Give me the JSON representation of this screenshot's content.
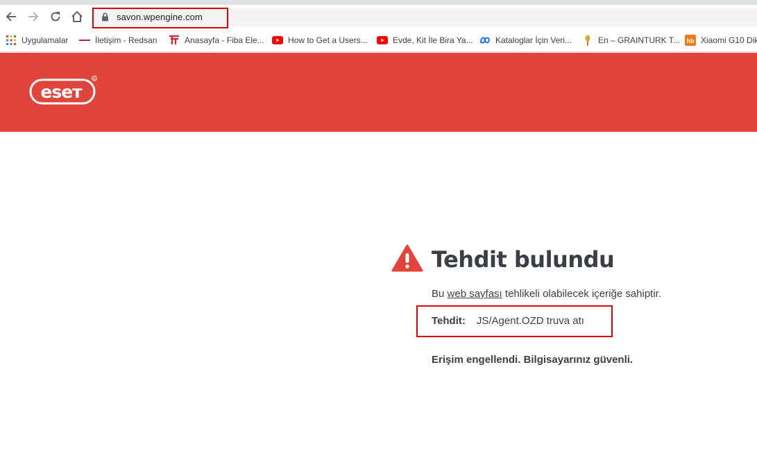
{
  "browser": {
    "url": "savon.wpengine.com",
    "bookmarks": [
      {
        "label": "Uygulamalar",
        "icon": "apps-grid-icon"
      },
      {
        "label": "İletişim - Redsan",
        "icon": "redsan-favicon"
      },
      {
        "label": "Anasayfa - Fiba Ele...",
        "icon": "fiba-favicon"
      },
      {
        "label": "How to Get a Users...",
        "icon": "youtube-icon"
      },
      {
        "label": "Evde, Kit İle Bira Ya...",
        "icon": "youtube-icon"
      },
      {
        "label": "Kataloglar İçin Veri...",
        "icon": "meta-icon"
      },
      {
        "label": "En – GRAINTURK T...",
        "icon": "grainturk-favicon"
      },
      {
        "label": "Xiaomi G10 Dik",
        "icon": "hb-favicon"
      }
    ]
  },
  "eset": {
    "logo_text": "eset",
    "brand_color": "#e0443b"
  },
  "alert": {
    "title": "Tehdit bulundu",
    "desc_prefix": "Bu ",
    "desc_link": "web sayfası",
    "desc_suffix": " tehlikeli olabilecek içeriğe sahiptir.",
    "threat_label": "Tehdit:",
    "threat_value": "JS/Agent.OZD truva atı",
    "blocked_message": "Erişim engellendi. Bilgisayarınız güvenli."
  },
  "colors": {
    "highlight": "#e10000",
    "text": "#3b3f45",
    "warning": "#e0443b"
  }
}
